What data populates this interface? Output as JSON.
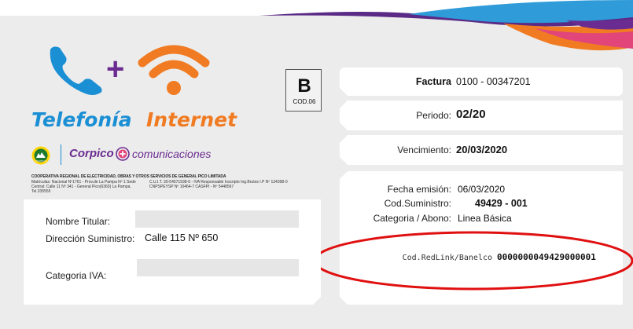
{
  "brand": {
    "telefonia": "Telefonía",
    "internet": "Internet",
    "plus_sign": "+",
    "corpico": "Corpico",
    "comunicaciones": "comunicaciones",
    "coop_badge": "CORPICO",
    "coop_name": "COOPERATIVA REGIONAL DE ELECTRICIDAD, OBRAS Y OTROS SERVICIOS DE GENERAL PICO LIMITADA",
    "fine_left": "Matrículas: Nacional Nº1761 - Prov.de La Pampa Nº 1 Sede Central: Calle 11 Nº 341 - General Pico(6360) La Pampa. Tel.335555",
    "fine_right": "C.U.I.T. 30-54571938-6 - IVA Responsable Inscripto Ing.Brutos I.P Nº 134398-0 CNPSPEYSP Nº 10464-7 CASFPI - Nº 5448567",
    "colors": {
      "blue": "#1b8fd4",
      "orange": "#f07b22",
      "purple": "#6b2c91",
      "red": "#e01010"
    }
  },
  "invoice_type": {
    "letter": "B",
    "code": "COD.06"
  },
  "factura": {
    "label": "Factura",
    "value": "0100 - 00347201"
  },
  "periodo": {
    "label": "Periodo:",
    "value": "02/20"
  },
  "vencimiento": {
    "label": "Vencimiento:",
    "value": "20/03/2020"
  },
  "details": {
    "fecha_emision_label": "Fecha emisión:",
    "fecha_emision_value": "06/03/2020",
    "cod_suministro_label": "Cod.Suministro:",
    "cod_suministro_value": "49429 - 001",
    "categoria_abono_label": "Categoria / Abono:",
    "categoria_abono_value": "Linea Básica"
  },
  "redlink": {
    "label": "Cod.RedLink/Banelco",
    "value": "0000000049429000001"
  },
  "titular": {
    "nombre_label": "Nombre Titular:",
    "nombre_value": "",
    "direccion_label": "Dirección Suministro:",
    "direccion_value": "Calle 115 Nº 650",
    "categoria_iva_label": "Categoria IVA:",
    "categoria_iva_value": ""
  }
}
